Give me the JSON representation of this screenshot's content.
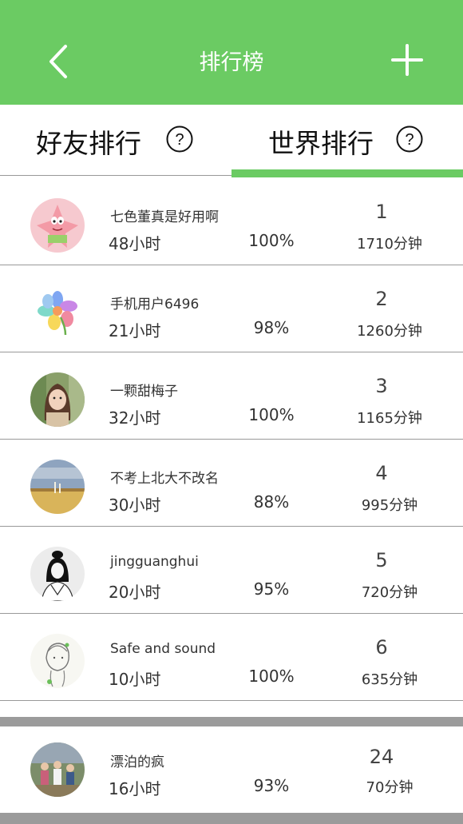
{
  "header": {
    "title": "排行榜",
    "back_icon": "chevron-left-icon",
    "add_icon": "plus-icon",
    "color": "#6bcb63"
  },
  "tabs": [
    {
      "label": "好友排行",
      "help_icon": "question-circle-icon",
      "active": false
    },
    {
      "label": "世界排行",
      "help_icon": "question-circle-icon",
      "active": true
    }
  ],
  "ranking": [
    {
      "name": "七色董真是好用啊",
      "hours": "48小时",
      "percent": "100%",
      "rank": "1",
      "minutes": "1710分钟",
      "avatar": "patrick-star-avatar"
    },
    {
      "name": "手机用户6496",
      "hours": "21小时",
      "percent": "98%",
      "rank": "2",
      "minutes": "1260分钟",
      "avatar": "colorful-flower-avatar"
    },
    {
      "name": "一颗甜梅子",
      "hours": "32小时",
      "percent": "100%",
      "rank": "3",
      "minutes": "1165分钟",
      "avatar": "girl-photo-avatar"
    },
    {
      "name": "不考上北大不改名",
      "hours": "30小时",
      "percent": "88%",
      "rank": "4",
      "minutes": "995分钟",
      "avatar": "landscape-avatar"
    },
    {
      "name": "jingguanghui",
      "hours": "20小时",
      "percent": "95%",
      "rank": "5",
      "minutes": "720分钟",
      "avatar": "ink-figure-avatar"
    },
    {
      "name": "Safe and sound",
      "hours": "10小时",
      "percent": "100%",
      "rank": "6",
      "minutes": "635分钟",
      "avatar": "sketch-girl-avatar"
    }
  ],
  "self": {
    "name": "漂泊的疯",
    "hours": "16小时",
    "percent": "93%",
    "rank": "24",
    "minutes": "70分钟",
    "avatar": "group-photo-avatar"
  }
}
